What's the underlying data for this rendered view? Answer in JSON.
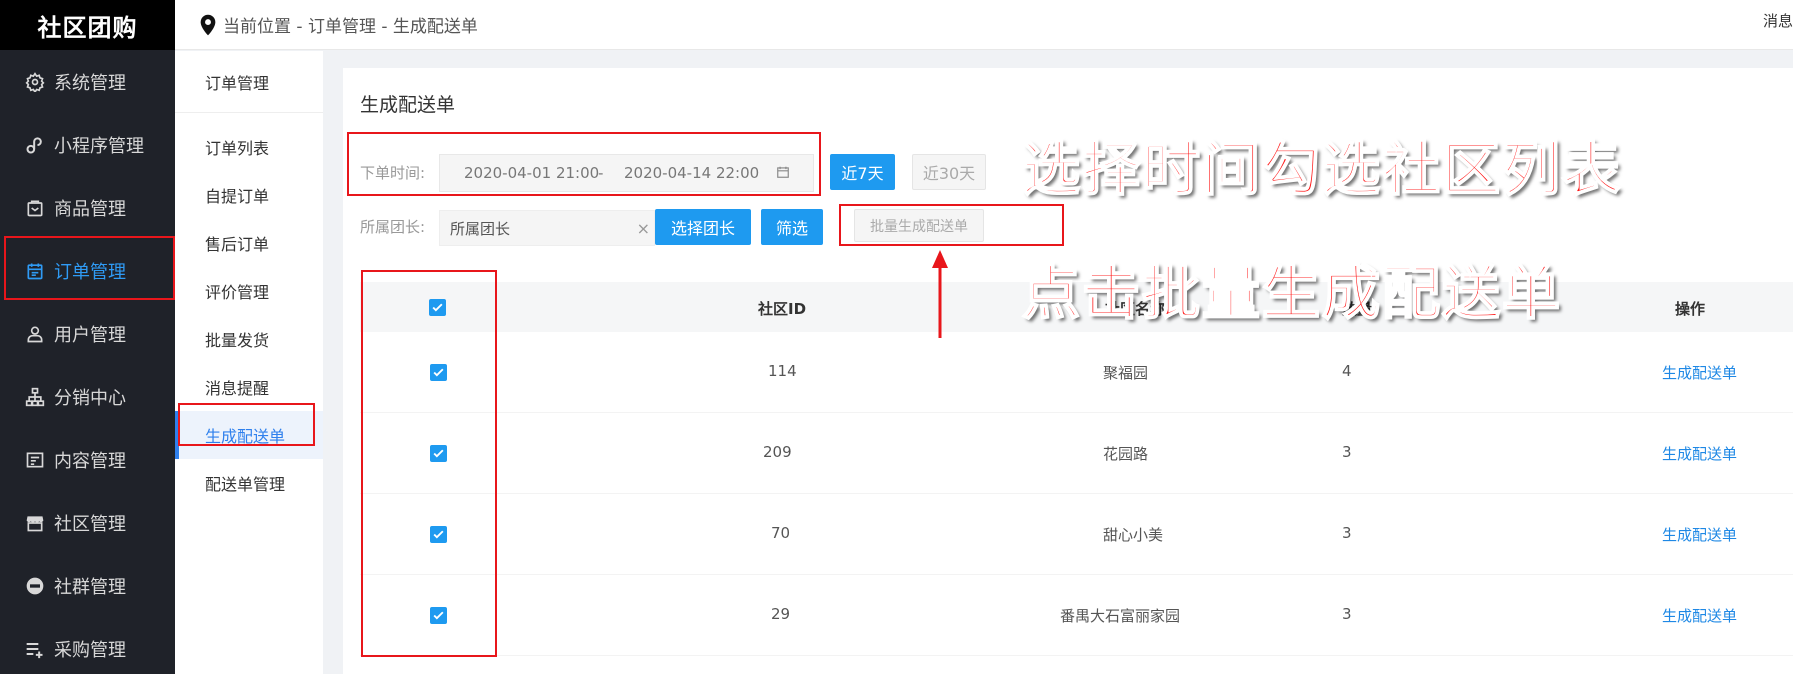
{
  "app": {
    "logo": "社区团购"
  },
  "sidebar": {
    "items": [
      {
        "label": "系统管理",
        "icon": "gear-icon"
      },
      {
        "label": "小程序管理",
        "icon": "link-icon"
      },
      {
        "label": "商品管理",
        "icon": "bag-icon"
      },
      {
        "label": "订单管理",
        "icon": "calendar-icon",
        "active": true
      },
      {
        "label": "用户管理",
        "icon": "user-icon"
      },
      {
        "label": "分销中心",
        "icon": "sitemap-icon"
      },
      {
        "label": "内容管理",
        "icon": "document-icon"
      },
      {
        "label": "社区管理",
        "icon": "store-icon"
      },
      {
        "label": "社群管理",
        "icon": "minus-circle-icon"
      },
      {
        "label": "采购管理",
        "icon": "list-add-icon"
      }
    ]
  },
  "topbar": {
    "breadcrumb": "当前位置 - 订单管理 - 生成配送单",
    "message": "消息"
  },
  "submenu": {
    "title": "订单管理",
    "items": [
      {
        "label": "订单列表"
      },
      {
        "label": "自提订单"
      },
      {
        "label": "售后订单"
      },
      {
        "label": "评价管理"
      },
      {
        "label": "批量发货"
      },
      {
        "label": "消息提醒"
      },
      {
        "label": "生成配送单",
        "active": true
      },
      {
        "label": "配送单管理"
      }
    ]
  },
  "main": {
    "title": "生成配送单",
    "filter": {
      "date_label": "下单时间:",
      "date_start": "2020-04-01 21:00",
      "date_sep": "-",
      "date_end": "2020-04-14 22:00",
      "btn_7days": "近7天",
      "btn_30days": "近30天",
      "leader_label": "所属团长:",
      "leader_value": "所属团长",
      "clear_icon": "×",
      "btn_select_leader": "选择团长",
      "btn_filter": "筛选",
      "btn_batch": "批量生成配送单"
    },
    "table": {
      "headers": [
        "社区ID",
        "社区名称",
        "数量",
        "操作"
      ],
      "rows": [
        {
          "id": "114",
          "name": "聚福园",
          "count": "4",
          "action": "生成配送单",
          "checked": true
        },
        {
          "id": "209",
          "name": "花园路",
          "count": "3",
          "action": "生成配送单",
          "checked": true
        },
        {
          "id": "70",
          "name": "甜心小美",
          "count": "3",
          "action": "生成配送单",
          "checked": true
        },
        {
          "id": "29",
          "name": "番禺大石富丽家园",
          "count": "3",
          "action": "生成配送单",
          "checked": true
        }
      ]
    }
  },
  "annotations": {
    "text1": "选择时间勾选社区列表",
    "text2": "点击批量生成配送单",
    "color": "#ff1010"
  }
}
